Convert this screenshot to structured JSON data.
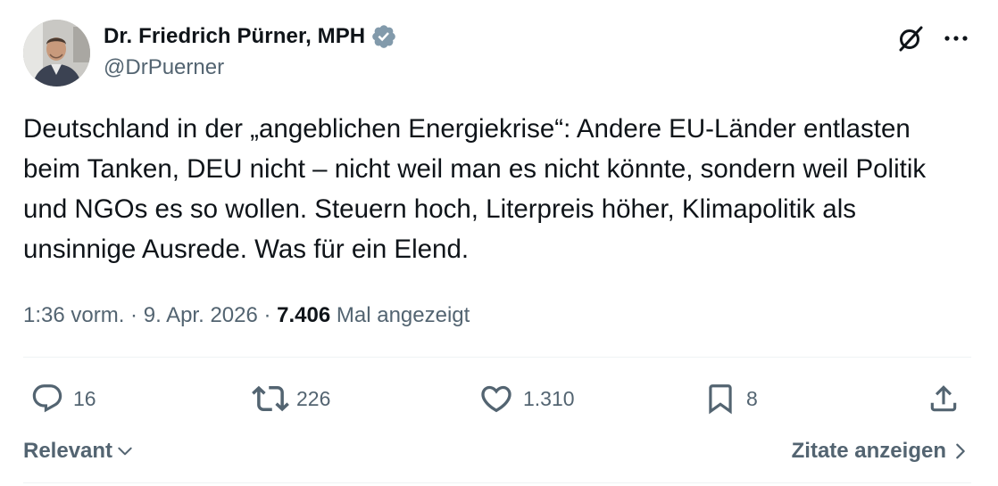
{
  "author": {
    "display_name": "Dr. Friedrich Pürner, MPH",
    "handle": "@DrPuerner",
    "verified": true
  },
  "tweet": {
    "text": "Deutschland in der „angeblichen Energiekrise“: Andere EU-Länder entlasten beim Tanken, DEU nicht – nicht weil man es nicht könnte, sondern weil Politik und NGOs es so wollen. Steuern hoch, Literpreis höher, Klimapolitik als unsinnige Ausrede. Was für ein Elend."
  },
  "meta": {
    "time": "1:36 vorm.",
    "separator": " · ",
    "date": "9. Apr. 2026",
    "views_count": "7.406",
    "views_label": "Mal angezeigt"
  },
  "actions": {
    "replies": "16",
    "reposts": "226",
    "likes": "1.310",
    "bookmarks": "8"
  },
  "footer": {
    "sort_label": "Relevant",
    "quotes_label": "Zitate anzeigen"
  },
  "icons": {
    "verified": "verified-badge-icon",
    "grok": "grok-icon",
    "more": "more-icon",
    "reply": "reply-icon",
    "repost": "repost-icon",
    "like": "like-icon",
    "bookmark": "bookmark-icon",
    "share": "share-icon"
  },
  "colors": {
    "text": "#0f1419",
    "secondary": "#536471",
    "verified_badge": "#829aab",
    "divider": "#eff3f4"
  }
}
